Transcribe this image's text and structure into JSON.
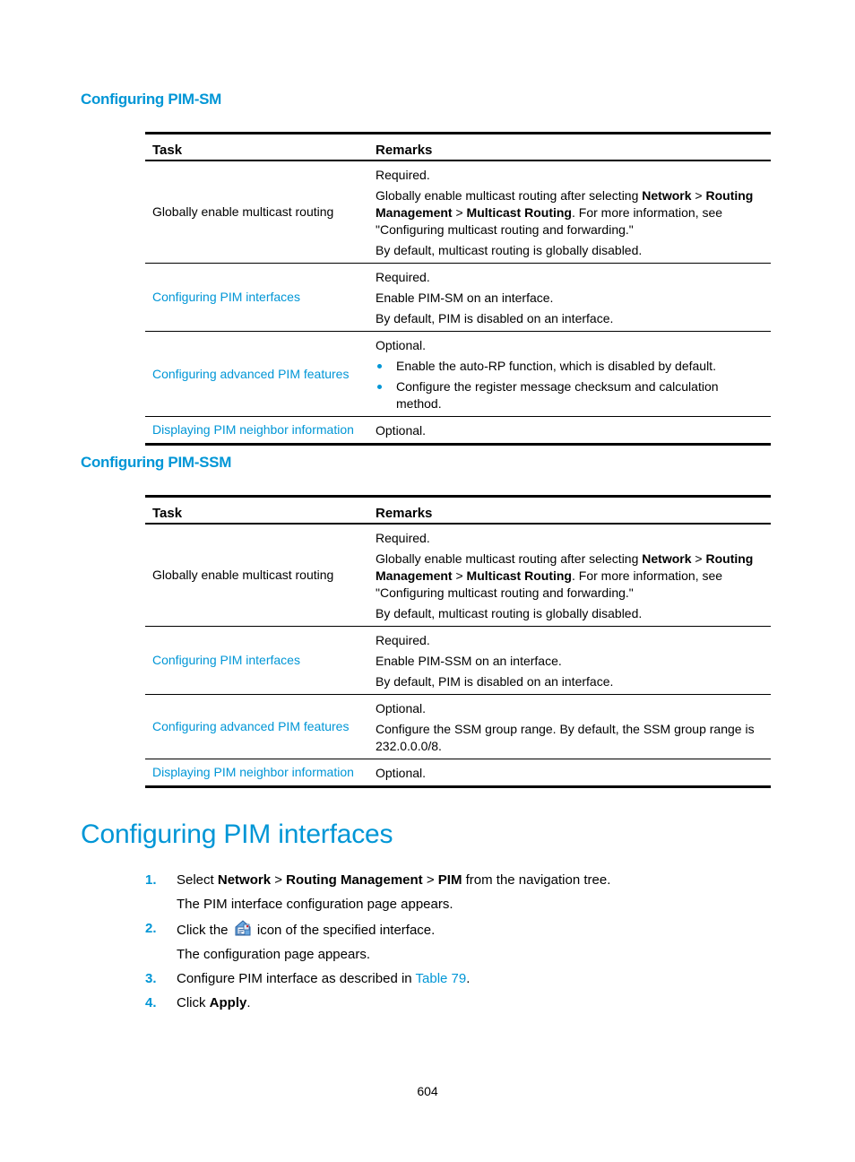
{
  "sections": {
    "pim_sm": {
      "heading": "Configuring PIM-SM",
      "table": {
        "headers": {
          "task": "Task",
          "remarks": "Remarks"
        },
        "rows": [
          {
            "task": "Globally enable multicast routing",
            "task_is_link": false,
            "remarks": {
              "required": "Required.",
              "p1_a": "Globally enable multicast routing after selecting ",
              "p1_b1": "Network",
              "p1_sep1": " > ",
              "p1_b2": "Routing Management",
              "p1_sep2": " > ",
              "p1_b3": "Multicast Routing",
              "p1_c": ".  For more information, see \"Configuring multicast routing and forwarding.\"",
              "default": "By default, multicast routing is globally disabled."
            }
          },
          {
            "task": "Configuring PIM interfaces",
            "task_is_link": true,
            "remarks": {
              "required": "Required.",
              "p1": "Enable PIM-SM on an interface.",
              "default": "By default, PIM is disabled on an interface."
            }
          },
          {
            "task": "Configuring advanced PIM features",
            "task_is_link": true,
            "remarks": {
              "required": "Optional.",
              "bullets": [
                "Enable the auto-RP function, which is disabled by default.",
                "Configure the register message checksum and calculation method."
              ]
            }
          },
          {
            "task": "Displaying PIM neighbor information",
            "task_is_link": true,
            "remarks": {
              "required": "Optional."
            }
          }
        ]
      }
    },
    "pim_ssm": {
      "heading": "Configuring PIM-SSM",
      "table": {
        "headers": {
          "task": "Task",
          "remarks": "Remarks"
        },
        "rows": [
          {
            "task": "Globally enable multicast routing",
            "task_is_link": false,
            "remarks": {
              "required": "Required.",
              "p1_a": "Globally enable multicast routing after selecting ",
              "p1_b1": "Network",
              "p1_sep1": " > ",
              "p1_b2": "Routing Management",
              "p1_sep2": " > ",
              "p1_b3": "Multicast Routing",
              "p1_c": ".  For more information, see \"Configuring multicast routing and forwarding.\"",
              "default": "By default, multicast routing is globally disabled."
            }
          },
          {
            "task": "Configuring PIM interfaces",
            "task_is_link": true,
            "remarks": {
              "required": "Required.",
              "p1": "Enable PIM-SSM on an interface.",
              "default": "By default, PIM is disabled on an interface."
            }
          },
          {
            "task": "Configuring advanced PIM features",
            "task_is_link": true,
            "remarks": {
              "required": "Optional.",
              "p1": "Configure the SSM group range. By default, the SSM group range is 232.0.0.0/8."
            }
          },
          {
            "task": "Displaying PIM neighbor information",
            "task_is_link": true,
            "remarks": {
              "required": "Optional."
            }
          }
        ]
      }
    }
  },
  "chapter": {
    "title": "Configuring PIM interfaces",
    "steps": [
      {
        "num": "1.",
        "a": "Select ",
        "b1": "Network",
        "sep1": " > ",
        "b2": "Routing Management",
        "sep2": " > ",
        "b3": "PIM",
        "c": " from the navigation tree.",
        "sub": "The PIM interface configuration page appears."
      },
      {
        "num": "2.",
        "a": "Click the ",
        "icon": "interface-config-icon",
        "c": " icon of the specified interface.",
        "sub": "The configuration page appears."
      },
      {
        "num": "3.",
        "a": "Configure PIM interface as described in ",
        "link": "Table 79",
        "c": "."
      },
      {
        "num": "4.",
        "a": "Click ",
        "b1": "Apply",
        "c": "."
      }
    ]
  },
  "footer": {
    "page_number": "604"
  },
  "colors": {
    "accent": "#0096d6",
    "text": "#000000",
    "background": "#ffffff"
  }
}
